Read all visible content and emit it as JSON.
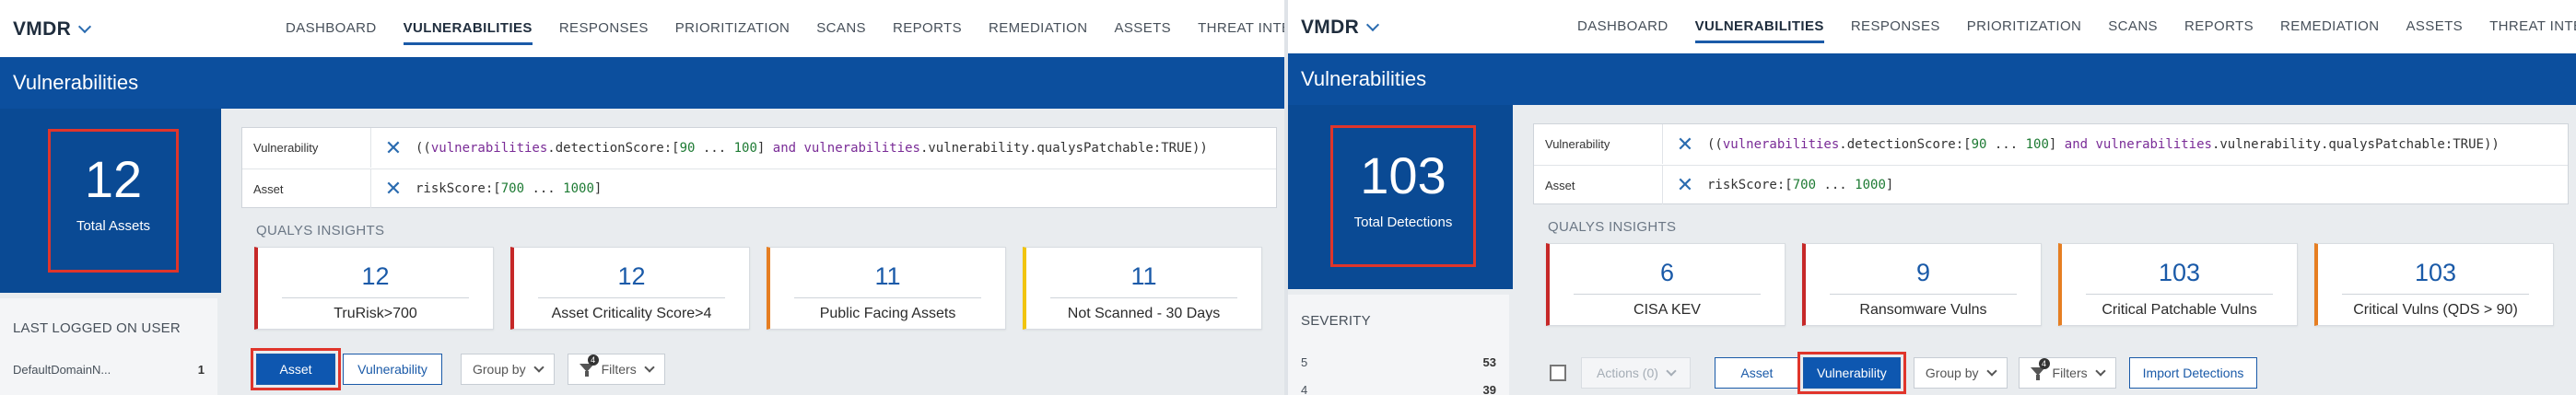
{
  "colors": {
    "brand_blue": "#0c4f9e",
    "highlight_red": "#e0352b",
    "card_red": "#c62828",
    "card_orange": "#e67e22",
    "card_yellow": "#f1c40f",
    "link_blue": "#1a5aa8"
  },
  "panels": [
    {
      "brand": "VMDR",
      "nav": [
        "DASHBOARD",
        "VULNERABILITIES",
        "RESPONSES",
        "PRIORITIZATION",
        "SCANS",
        "REPORTS",
        "REMEDIATION",
        "ASSETS",
        "THREAT INTELLIGENCE"
      ],
      "active_nav": "VULNERABILITIES",
      "title": "Vulnerabilities",
      "kpi": {
        "value": "12",
        "label": "Total Assets"
      },
      "query": [
        {
          "label": "Vulnerability",
          "text": "((vulnerabilities.detectionScore:[90 ... 100] and vulnerabilities.vulnerability.qualysPatchable:TRUE))"
        },
        {
          "label": "Asset",
          "text": "riskScore:[700 ... 1000]"
        }
      ],
      "insights_title": "QUALYS INSIGHTS",
      "cards": [
        {
          "value": "12",
          "label": "TruRisk>700",
          "accent": "card_red"
        },
        {
          "value": "12",
          "label": "Asset Criticality Score>4",
          "accent": "card_red"
        },
        {
          "value": "11",
          "label": "Public Facing Assets",
          "accent": "card_orange"
        },
        {
          "value": "11",
          "label": "Not Scanned - 30 Days",
          "accent": "card_yellow"
        }
      ],
      "side": {
        "title": "LAST LOGGED ON USER",
        "rows": [
          {
            "label": "DefaultDomainN...",
            "value": "1"
          }
        ]
      },
      "toolbar": {
        "asset": "Asset",
        "vulnerability": "Vulnerability",
        "group_by": "Group by",
        "filters": "Filters",
        "filter_count": "4",
        "selected": "Asset"
      }
    },
    {
      "brand": "VMDR",
      "nav": [
        "DASHBOARD",
        "VULNERABILITIES",
        "RESPONSES",
        "PRIORITIZATION",
        "SCANS",
        "REPORTS",
        "REMEDIATION",
        "ASSETS",
        "THREAT INTELLIGENCE"
      ],
      "active_nav": "VULNERABILITIES",
      "title": "Vulnerabilities",
      "kpi": {
        "value": "103",
        "label": "Total Detections"
      },
      "query": [
        {
          "label": "Vulnerability",
          "text": "((vulnerabilities.detectionScore:[90 ... 100] and vulnerabilities.vulnerability.qualysPatchable:TRUE))"
        },
        {
          "label": "Asset",
          "text": "riskScore:[700 ... 1000]"
        }
      ],
      "insights_title": "QUALYS INSIGHTS",
      "cards": [
        {
          "value": "6",
          "label": "CISA KEV",
          "accent": "card_red"
        },
        {
          "value": "9",
          "label": "Ransomware Vulns",
          "accent": "card_red"
        },
        {
          "value": "103",
          "label": "Critical Patchable Vulns",
          "accent": "card_orange"
        },
        {
          "value": "103",
          "label": "Critical Vulns (QDS > 90)",
          "accent": "card_orange"
        }
      ],
      "side": {
        "title": "SEVERITY",
        "rows": [
          {
            "label": "5",
            "value": "53"
          },
          {
            "label": "4",
            "value": "39"
          }
        ]
      },
      "toolbar": {
        "actions": "Actions (0)",
        "asset": "Asset",
        "vulnerability": "Vulnerability",
        "group_by": "Group by",
        "filters": "Filters",
        "filter_count": "4",
        "import": "Import Detections",
        "selected": "Vulnerability"
      }
    }
  ]
}
